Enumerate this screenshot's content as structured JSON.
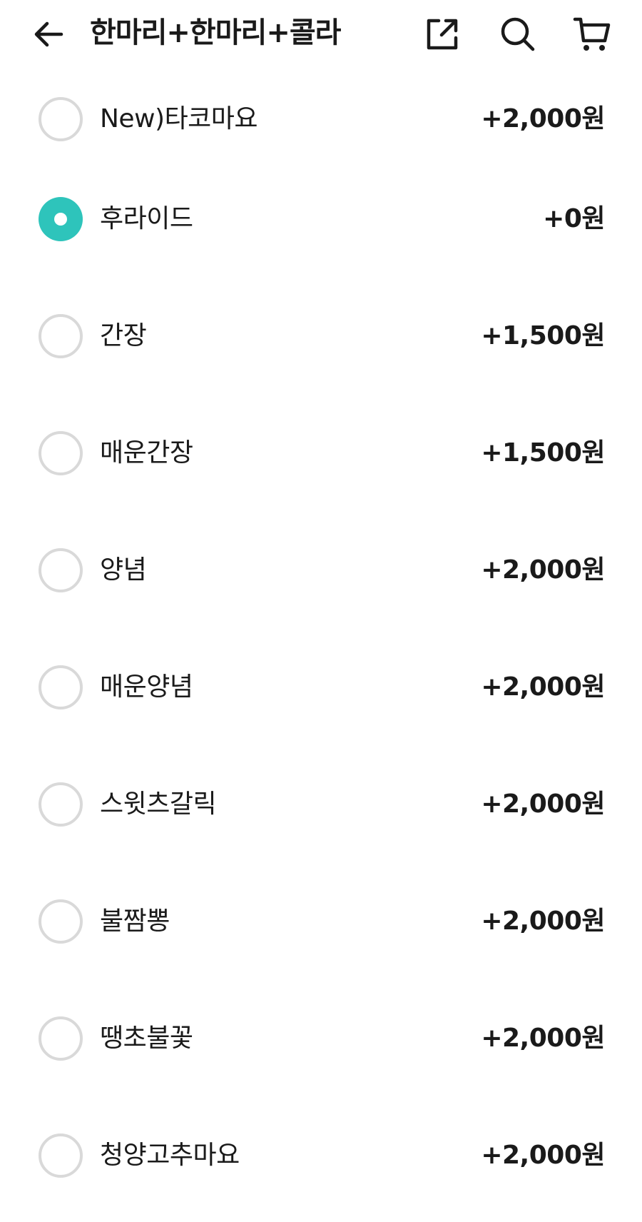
{
  "header": {
    "title": "한마리+한마리+콜라",
    "back_icon": "arrow-left-icon",
    "share_icon": "share-icon",
    "search_icon": "search-icon",
    "cart_icon": "cart-icon"
  },
  "colors": {
    "accent": "#2ec4bb",
    "radio_border": "#d9d9d9",
    "text": "#1a1a1a"
  },
  "options": [
    {
      "label": "New)타코마요",
      "price": "+2,000원",
      "selected": false
    },
    {
      "label": "후라이드",
      "price": "+0원",
      "selected": true
    },
    {
      "label": "간장",
      "price": "+1,500원",
      "selected": false
    },
    {
      "label": "매운간장",
      "price": "+1,500원",
      "selected": false
    },
    {
      "label": "양념",
      "price": "+2,000원",
      "selected": false
    },
    {
      "label": "매운양념",
      "price": "+2,000원",
      "selected": false
    },
    {
      "label": "스윗츠갈릭",
      "price": "+2,000원",
      "selected": false
    },
    {
      "label": "불짬뽕",
      "price": "+2,000원",
      "selected": false
    },
    {
      "label": "땡초불꽃",
      "price": "+2,000원",
      "selected": false
    },
    {
      "label": "청양고추마요",
      "price": "+2,000원",
      "selected": false
    }
  ]
}
